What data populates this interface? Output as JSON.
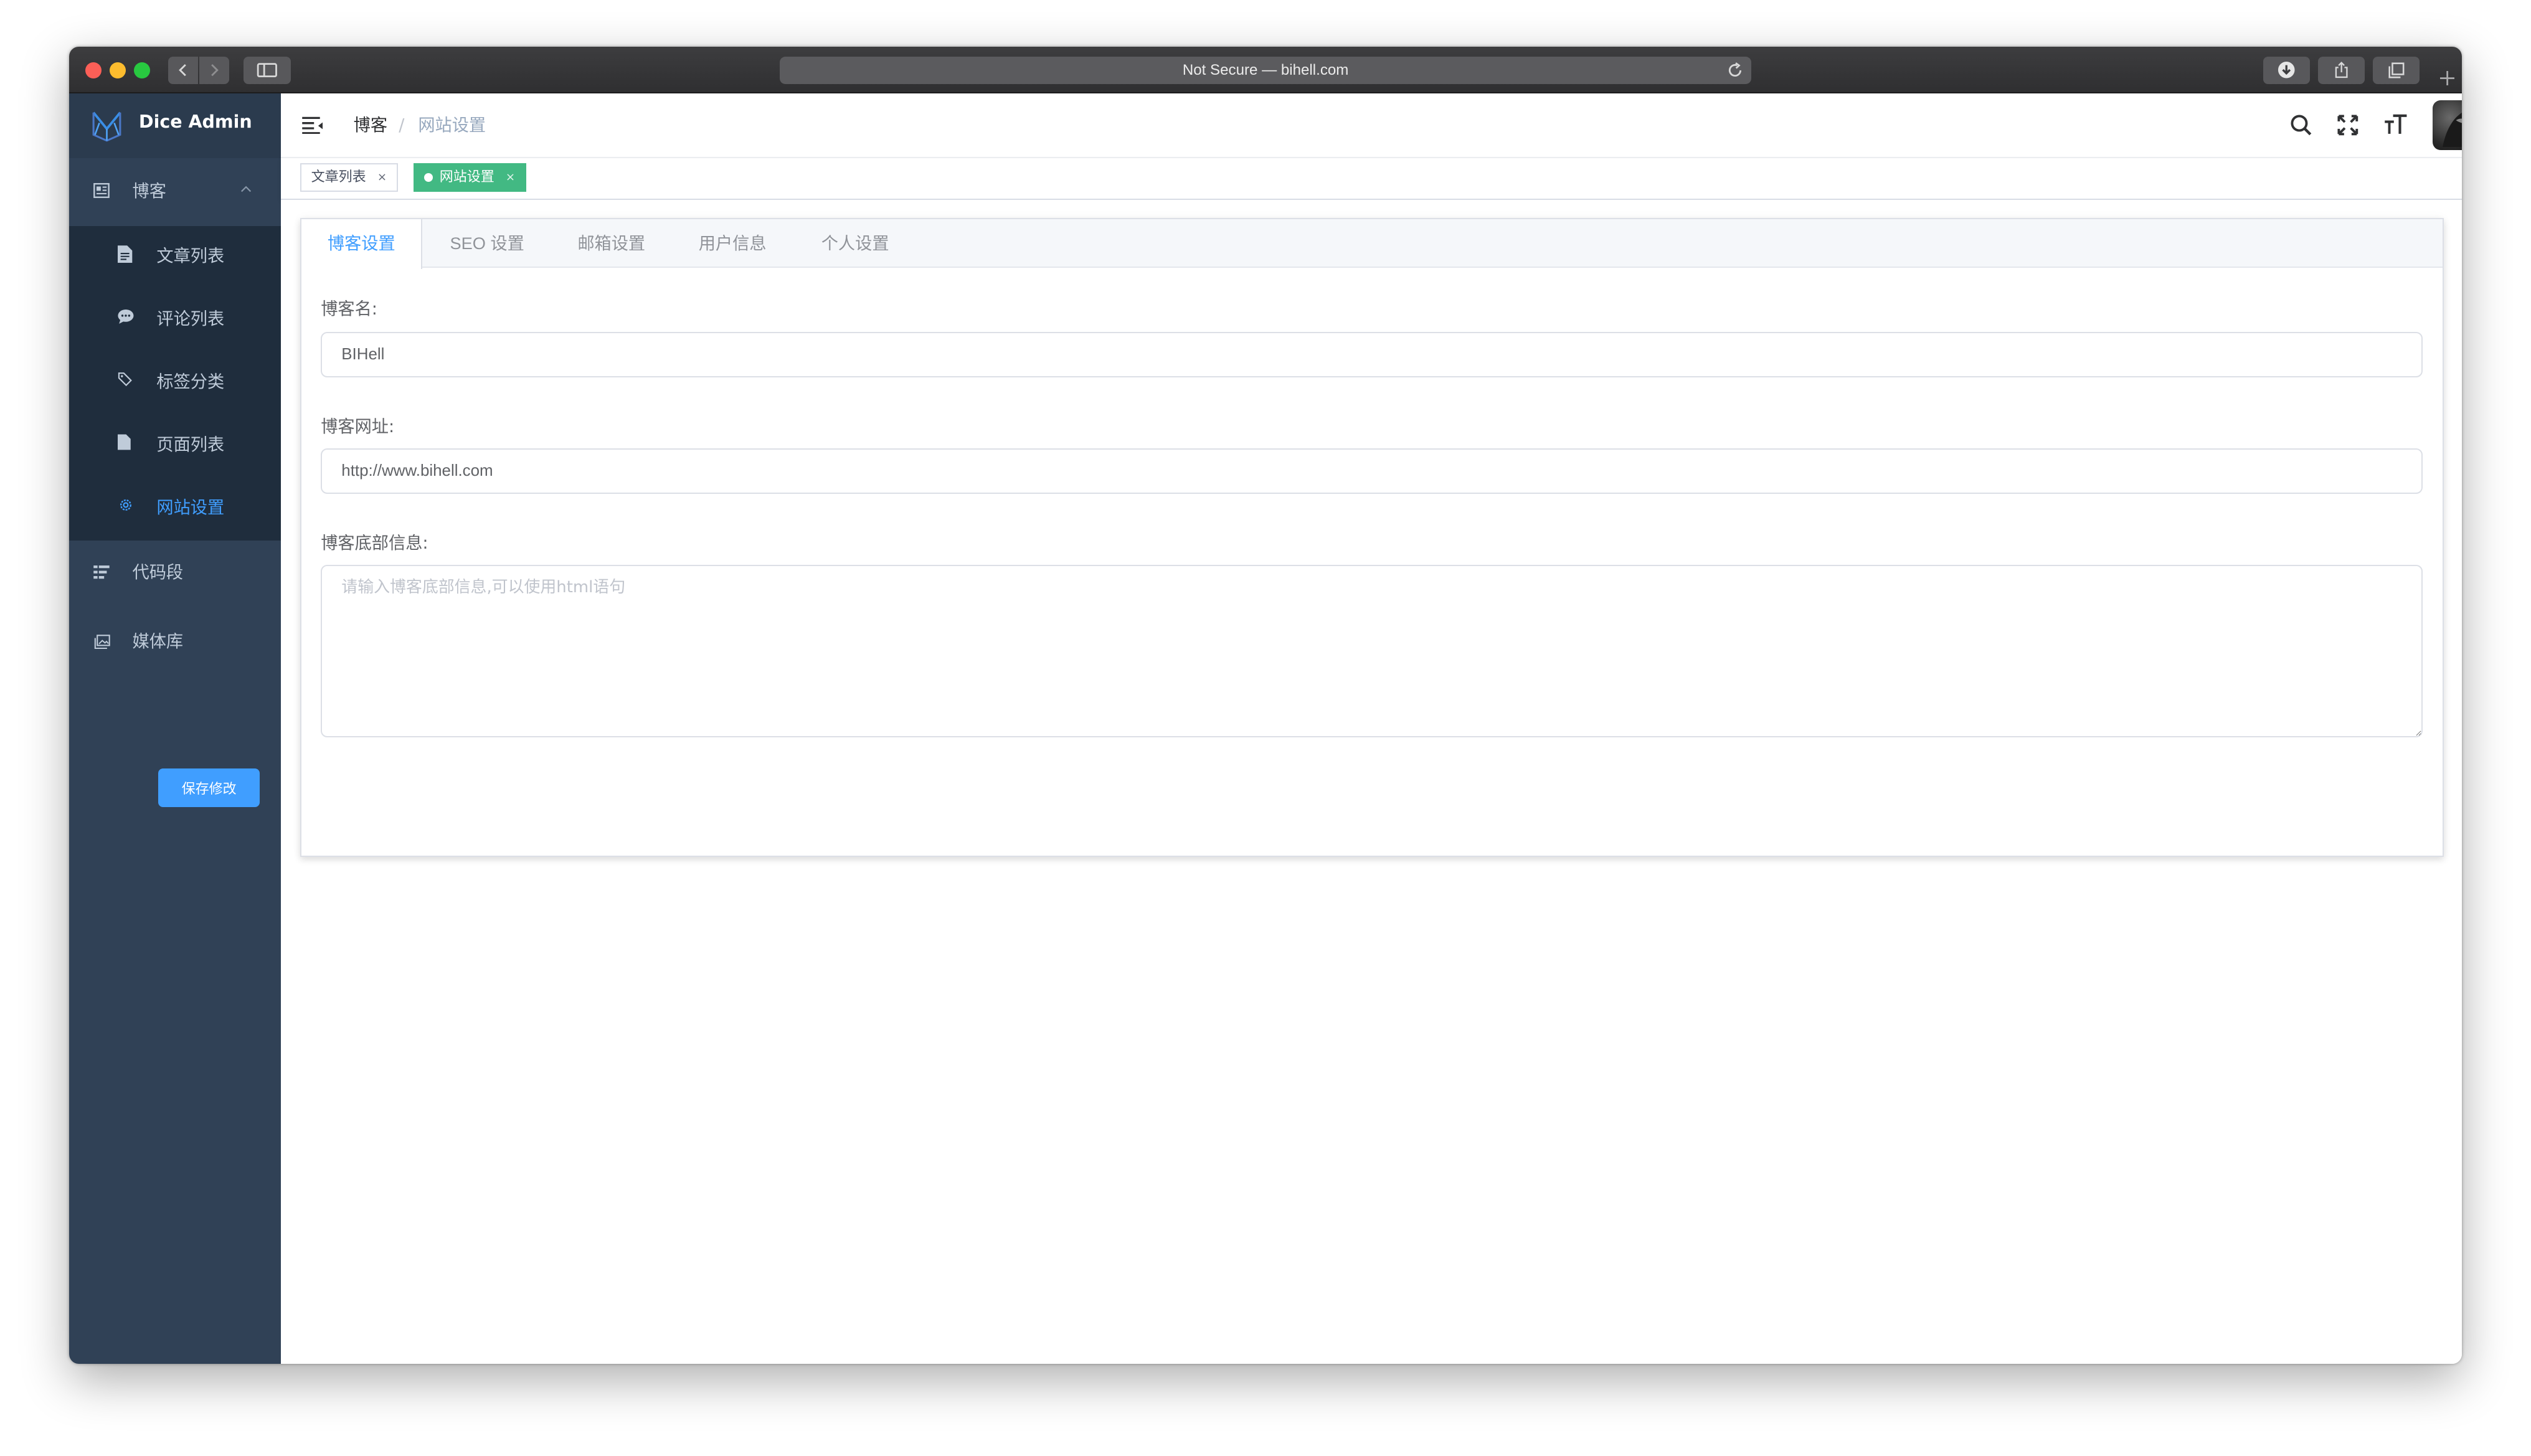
{
  "browser": {
    "address": "Not Secure — bihell.com"
  },
  "sidebar": {
    "brand": "Dice Admin",
    "menu": [
      {
        "label": "博客",
        "expanded": true,
        "children": [
          {
            "label": "文章列表"
          },
          {
            "label": "评论列表"
          },
          {
            "label": "标签分类"
          },
          {
            "label": "页面列表"
          },
          {
            "label": "网站设置",
            "active": true
          }
        ]
      },
      {
        "label": "代码段"
      },
      {
        "label": "媒体库"
      }
    ]
  },
  "navbar": {
    "breadcrumb": [
      "博客",
      "网站设置"
    ],
    "separator": "/"
  },
  "tags": [
    {
      "label": "文章列表",
      "close": "×"
    },
    {
      "label": "网站设置",
      "close": "×",
      "active": true
    }
  ],
  "tabs": [
    "博客设置",
    "SEO 设置",
    "邮箱设置",
    "用户信息",
    "个人设置"
  ],
  "form": {
    "blog_name_label": "博客名:",
    "blog_name_value": "BIHell",
    "blog_url_label": "博客网址:",
    "blog_url_value": "http://www.bihell.com",
    "footer_label": "博客底部信息:",
    "footer_placeholder": "请输入博客底部信息,可以使用html语句",
    "save_label": "保存修改"
  },
  "colors": {
    "sidebar_bg": "#304156",
    "submenu_bg": "#1f2d3d",
    "accent": "#409eff",
    "tag_active": "#42b983"
  }
}
